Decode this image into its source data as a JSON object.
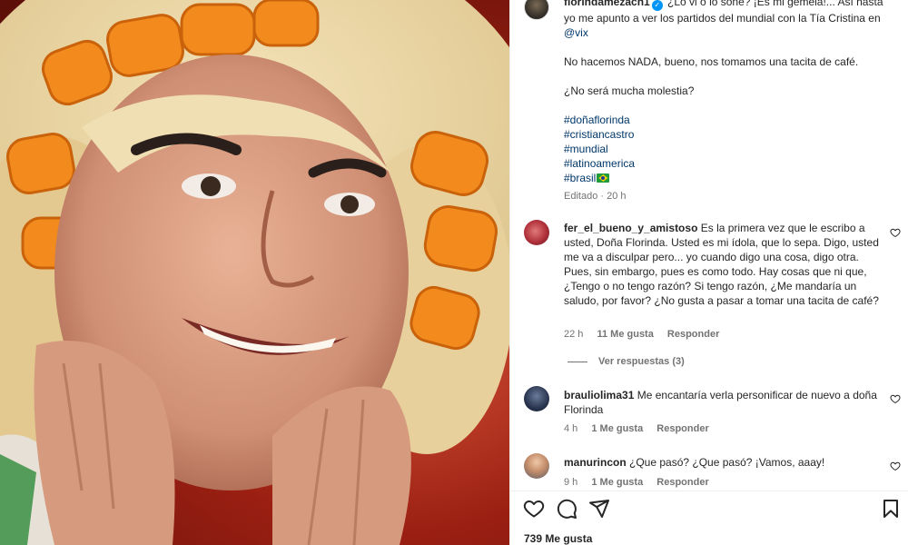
{
  "post": {
    "author": "florindamezach1",
    "caption_text": "¿Lo vi o lo soñé? ¡Es mi gemela!... Así hasta yo me apunto a ver los partidos del mundial con la Tía Cristina en ",
    "caption_mention": "@vix",
    "caption_p2": "No hacemos NADA, bueno, nos tomamos una tacita de café.",
    "caption_p3": "¿No será mucha molestia?",
    "hashtags": [
      "#doñaflorinda",
      "#cristiancastro",
      "#mundial",
      "#latinoamerica",
      "#brasil"
    ],
    "edited_label": "Editado",
    "edited_time": "20 h"
  },
  "comments": [
    {
      "username": "fer_el_bueno_y_amistoso",
      "text": "Es la primera vez que le escribo a usted, Doña Florinda. Usted es mi ídola, que lo sepa. Digo, usted me va a disculpar pero... yo cuando digo una cosa, digo otra. Pues, sin embargo, pues es como todo. Hay cosas que ni que, ¿Tengo o no tengo razón? Si tengo razón, ¿Me mandaría un saludo, por favor? ¿No gusta a pasar a tomar una tacita de café?",
      "time": "22 h",
      "likes": "11 Me gusta",
      "reply": "Responder"
    },
    {
      "username": "brauliolima31",
      "text": "Me encantaría verla personificar de nuevo a doña Florinda",
      "time": "4 h",
      "likes": "1 Me gusta",
      "reply": "Responder"
    },
    {
      "username": "manurincon",
      "text": "¿Que pasó? ¿Que pasó? ¡Vamos, aaay!",
      "time": "9 h",
      "likes": "1 Me gusta",
      "reply": "Responder"
    }
  ],
  "view_replies": "Ver respuestas (3)",
  "likes_total": "739 Me gusta",
  "icons": {
    "like": "heart-icon",
    "comment": "comment-icon",
    "share": "share-icon",
    "save": "bookmark-icon",
    "verified": "verified-badge-icon"
  },
  "colors": {
    "link": "#00376b",
    "verified": "#0095f6",
    "meta": "#737373",
    "text": "#262626"
  }
}
